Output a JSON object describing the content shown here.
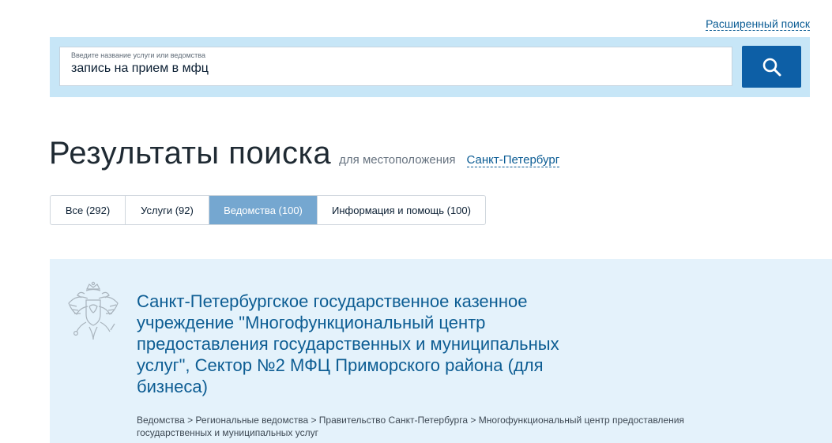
{
  "advanced_search": {
    "label": "Расширенный поиск"
  },
  "search": {
    "hint": "Введите название услуги или ведомства",
    "value": "запись на прием в мфц",
    "button_icon": "search-icon"
  },
  "results": {
    "title": "Результаты поиска",
    "location_label": "для местоположения",
    "location_value": "Санкт-Петербург"
  },
  "tabs": [
    {
      "label": "Все (292)",
      "active": false
    },
    {
      "label": "Услуги (92)",
      "active": false
    },
    {
      "label": "Ведомства (100)",
      "active": true
    },
    {
      "label": "Информация и помощь (100)",
      "active": false
    }
  ],
  "result_item": {
    "icon": "coat-of-arms-icon",
    "title": "Санкт-Петербургское государственное казенное учреждение \"Многофункциональный центр предоставления государственных и муниципальных услуг\", Сектор №2 МФЦ Приморского района (для бизнеса)",
    "breadcrumb": "Ведомства > Региональные ведомства > Правительство Санкт-Петербурга > Многофункциональный центр предоставления государственных и муниципальных услуг"
  },
  "colors": {
    "search_bar_bg": "#c7e6f7",
    "search_button": "#0d5fa6",
    "active_tab": "#75a7d0",
    "link": "#0b5c94",
    "result_card_bg": "#e4f2fb"
  }
}
